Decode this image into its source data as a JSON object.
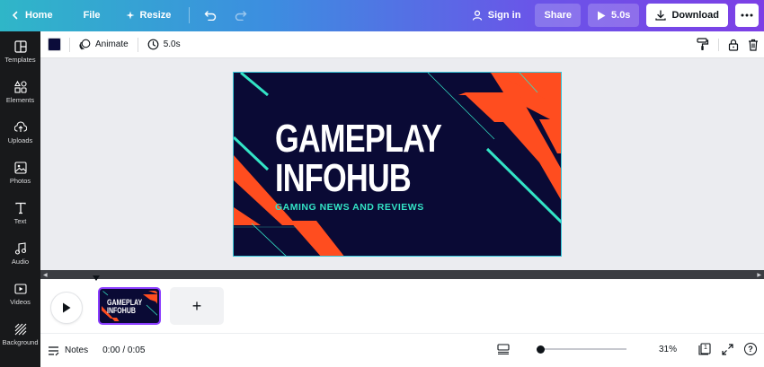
{
  "topbar": {
    "home_label": "Home",
    "file_label": "File",
    "resize_label": "Resize",
    "signin_label": "Sign in",
    "share_label": "Share",
    "play_label": "5.0s",
    "download_label": "Download"
  },
  "sidebar": {
    "items": [
      {
        "label": "Templates",
        "icon": "templates-icon"
      },
      {
        "label": "Elements",
        "icon": "elements-icon"
      },
      {
        "label": "Uploads",
        "icon": "uploads-icon"
      },
      {
        "label": "Photos",
        "icon": "photos-icon"
      },
      {
        "label": "Text",
        "icon": "text-icon"
      },
      {
        "label": "Audio",
        "icon": "audio-icon"
      },
      {
        "label": "Videos",
        "icon": "videos-icon"
      },
      {
        "label": "Background",
        "icon": "background-icon"
      }
    ]
  },
  "toolbar": {
    "color_value": "#0b0c3a",
    "animate_label": "Animate",
    "duration_label": "5.0s"
  },
  "design": {
    "title_line1": "GAMEPLAY",
    "title_line2": "INFOHUB",
    "subtitle": "GAMING NEWS AND REVIEWS",
    "colors": {
      "background": "#0a0a35",
      "accent_orange": "#ff4d1f",
      "accent_teal": "#33e4c6"
    }
  },
  "timeline": {
    "thumb_title_line1": "GAMEPLAY",
    "thumb_title_line2": "INFOHUB",
    "add_page_label": "+"
  },
  "footer": {
    "notes_label": "Notes",
    "time_label": "0:00 / 0:05",
    "zoom_percent": 31,
    "zoom_label": "31%",
    "page_count": "1",
    "help_label": "?"
  }
}
